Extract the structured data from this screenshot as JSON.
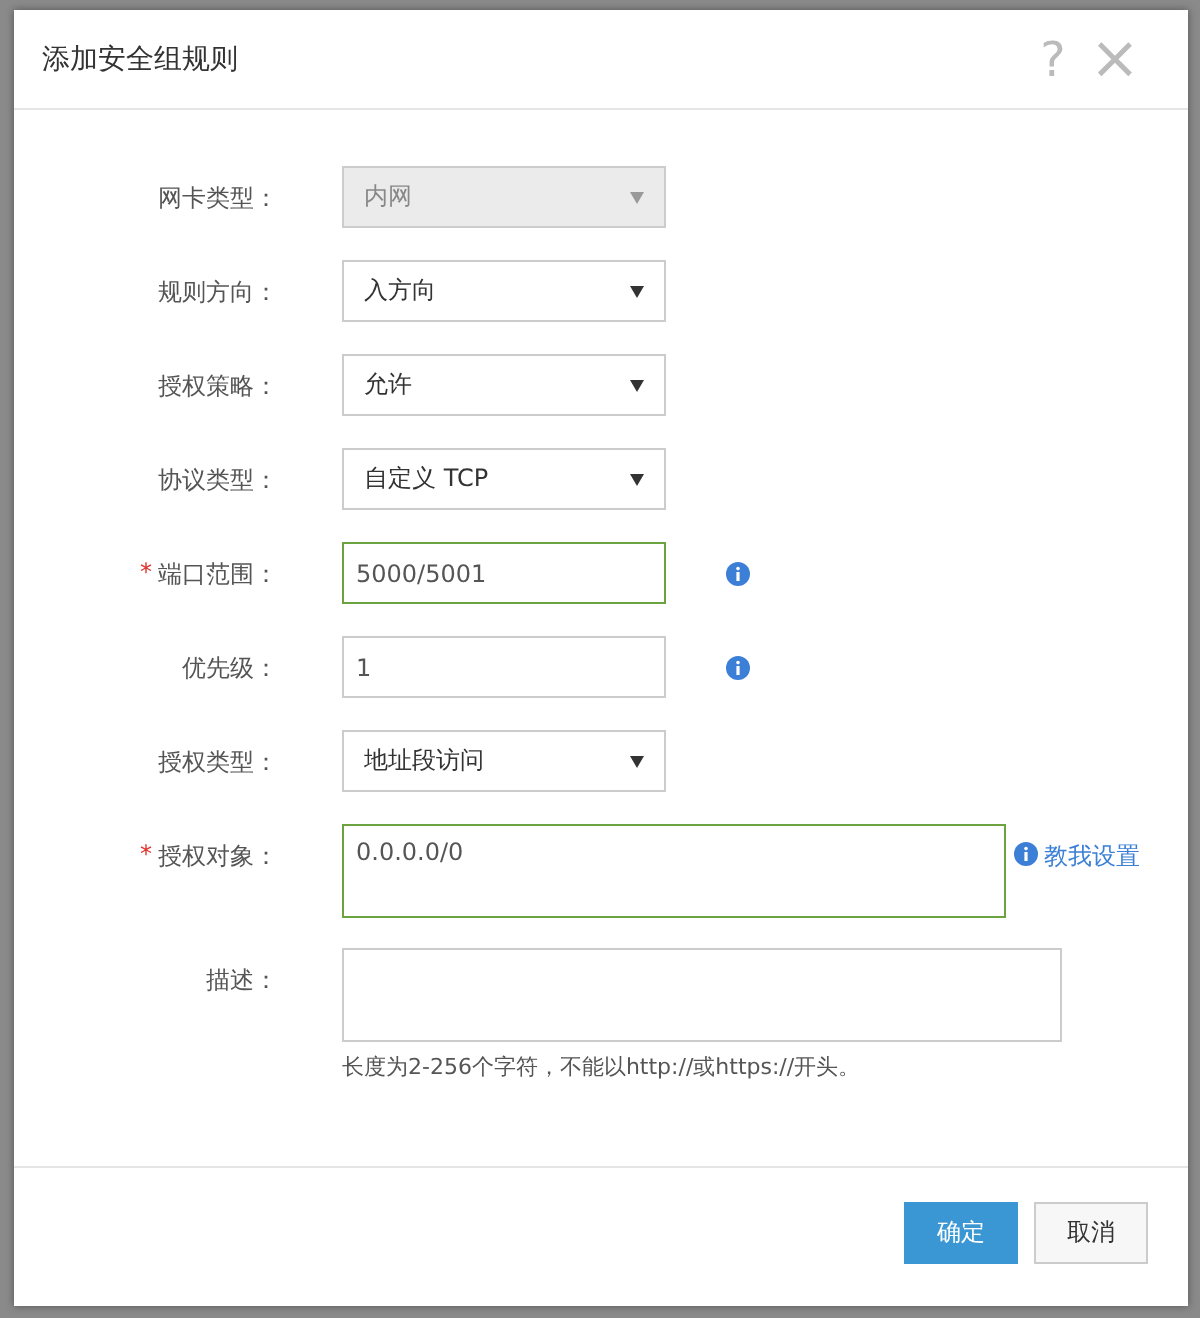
{
  "dialog": {
    "title": "添加安全组规则",
    "help": "?",
    "close": "×"
  },
  "fields": [
    {
      "label": "网卡类型：",
      "kind": "select",
      "value": "内网",
      "disabled": true,
      "focused": false,
      "info": false
    },
    {
      "label": "规则方向：",
      "kind": "select",
      "value": "入方向",
      "disabled": false,
      "focused": false,
      "info": false
    },
    {
      "label": "授权策略：",
      "kind": "select",
      "value": "允许",
      "disabled": false,
      "focused": false,
      "info": false
    },
    {
      "label": "协议类型：",
      "kind": "select",
      "value": "自定义 TCP",
      "disabled": false,
      "focused": false,
      "info": false
    },
    {
      "label": "端口范围：",
      "required_mark": "*",
      "kind": "input",
      "value": "5000/5001",
      "disabled": false,
      "focused": true,
      "info": true
    },
    {
      "label": "优先级：",
      "kind": "input",
      "value": "1",
      "disabled": false,
      "focused": false,
      "info": true
    },
    {
      "label": "授权类型：",
      "kind": "select",
      "value": "地址段访问",
      "disabled": false,
      "focused": false,
      "info": false
    },
    {
      "label": "授权对象：",
      "required_mark": "*",
      "kind": "textarea",
      "value": "0.0.0.0/0",
      "disabled": false,
      "focused": true,
      "info": true,
      "link": "教我设置"
    },
    {
      "label": "描述：",
      "kind": "textarea",
      "disabled": false,
      "focused": false,
      "info": false,
      "hint": "长度为2-256个字符，不能以http://或https://开头。"
    }
  ],
  "buttons": [
    {
      "label": "确定",
      "kind": "primary"
    },
    {
      "label": "取消",
      "kind": "secondary"
    }
  ]
}
